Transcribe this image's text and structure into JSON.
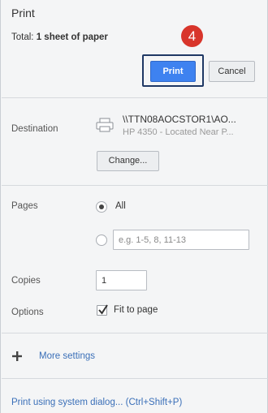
{
  "dialog": {
    "title": "Print",
    "total_label": "Total:",
    "total_value": "1 sheet of paper",
    "step_badge": "4",
    "print_label": "Print",
    "cancel_label": "Cancel"
  },
  "destination": {
    "label": "Destination",
    "printer_name": "\\\\TTN08AOCSTOR1\\AO...",
    "printer_detail": "HP 4350 - Located Near P...",
    "icon": "printer-icon",
    "change_label": "Change..."
  },
  "pages": {
    "label": "Pages",
    "option_all": "All",
    "selected": "All",
    "custom_placeholder": "e.g. 1-5, 8, 11-13"
  },
  "copies": {
    "label": "Copies",
    "value": "1"
  },
  "options": {
    "label": "Options",
    "fit_to_page_label": "Fit to page",
    "fit_to_page_checked": true
  },
  "more_settings": {
    "label": "More settings",
    "icon": "plus-icon"
  },
  "system_dialog_link": "Print using system dialog... (Ctrl+Shift+P)",
  "colors": {
    "accent": "#3e82f0",
    "badge": "#d8352b",
    "link": "#3a6fb8",
    "highlight_border": "#1f3864"
  }
}
